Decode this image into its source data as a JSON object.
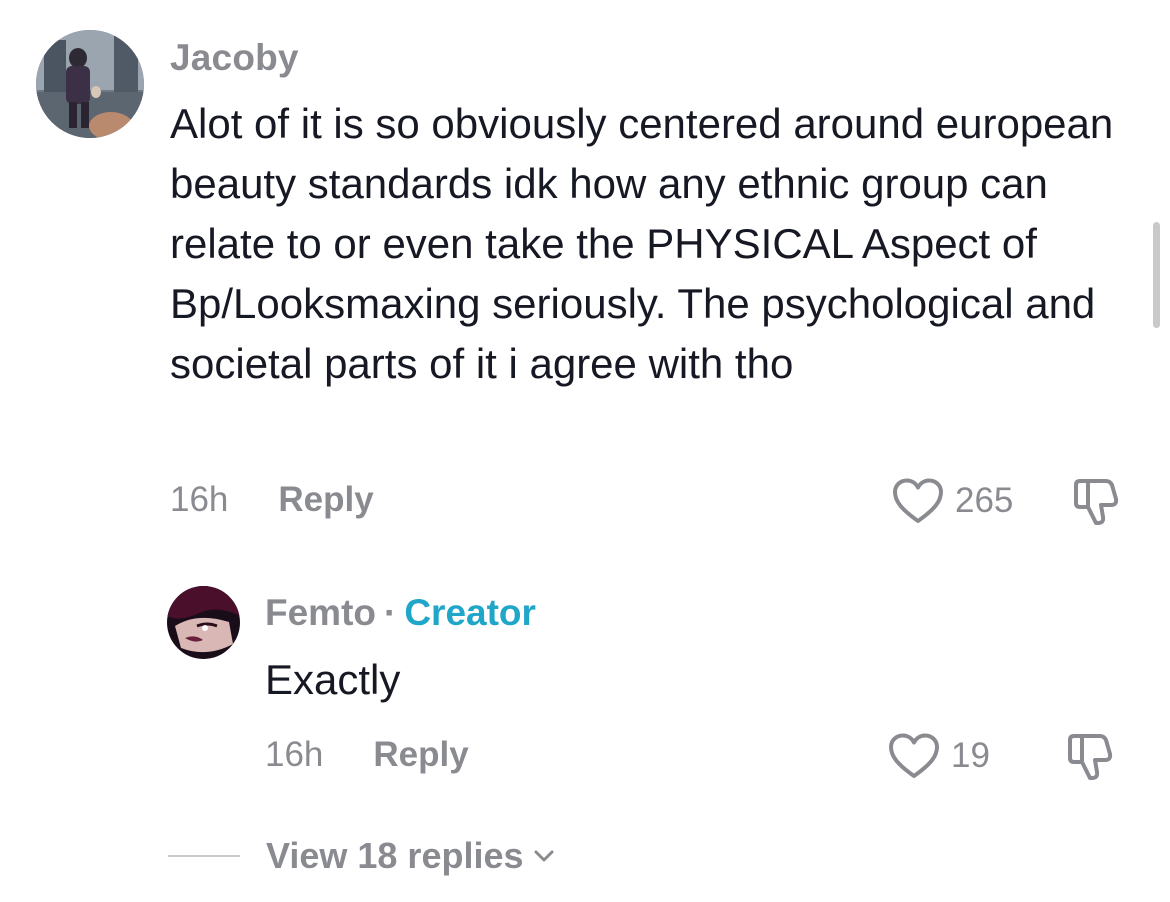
{
  "comments": [
    {
      "username": "Jacoby",
      "text": "Alot of it is so obviously centered around european beauty standards idk how any ethnic group can relate to or even take the PHYSICAL Aspect of Bp/Looksmaxing seriously. The psychological and societal parts of it i agree with tho",
      "time": "16h",
      "reply_label": "Reply",
      "likes": "265"
    },
    {
      "username": "Femto",
      "separator": "·",
      "badge": "Creator",
      "text": "Exactly",
      "time": "16h",
      "reply_label": "Reply",
      "likes": "19"
    }
  ],
  "view_replies": "View 18 replies",
  "icons": {
    "like": "heart-outline-icon",
    "dislike": "thumbs-down-icon",
    "expand": "chevron-down-icon"
  },
  "colors": {
    "text": "#161823",
    "muted": "#8a8b91",
    "creator_badge": "#20a6c9"
  }
}
